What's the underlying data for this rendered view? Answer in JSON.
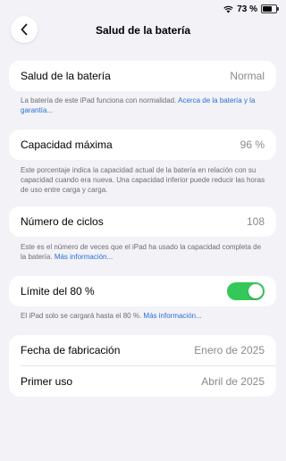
{
  "status_bar": {
    "battery_percent": "73 %",
    "battery_level": 0.73
  },
  "header": {
    "title": "Salud de la batería"
  },
  "health": {
    "label": "Salud de la batería",
    "value": "Normal",
    "note": "La batería de este iPad funciona con normalidad.",
    "link": "Acerca de la batería y la garantía..."
  },
  "capacity": {
    "label": "Capacidad máxima",
    "value": "96 %",
    "note": "Este porcentaje indica la capacidad actual de la batería en relación con su capacidad cuando era nueva. Una capacidad inferior puede reducir las horas de uso entre carga y carga."
  },
  "cycles": {
    "label": "Número de ciclos",
    "value": "108",
    "note": "Este es el número de veces que el iPad ha usado la capacidad completa de la batería.",
    "link": "Más información..."
  },
  "limit": {
    "label": "Límite del 80 %",
    "enabled": true,
    "toggle_color": "#34c759",
    "note": "El iPad solo se cargará hasta el 80 %.",
    "link": "Más información..."
  },
  "dates": {
    "manufacture_label": "Fecha de fabricación",
    "manufacture_value": "Enero de 2025",
    "first_use_label": "Primer uso",
    "first_use_value": "Abril de 2025"
  }
}
